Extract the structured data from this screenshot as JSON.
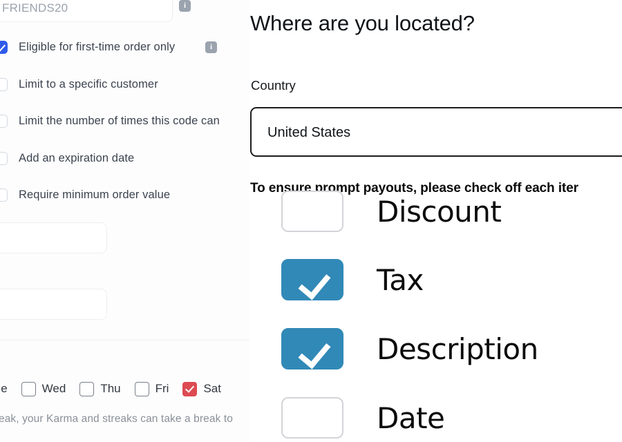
{
  "left_panel": {
    "promo_input": {
      "placeholder": "FRIENDS20",
      "value": ""
    },
    "info_icon_name": "info-icon",
    "options": [
      {
        "label": "Eligible for first-time order only",
        "checked": true,
        "has_info": true
      },
      {
        "label": "Limit to a specific customer",
        "checked": false,
        "has_info": false
      },
      {
        "label": "Limit the number of times this code can",
        "checked": false,
        "has_info": false
      },
      {
        "label": "Add an expiration date",
        "checked": false,
        "has_info": false
      },
      {
        "label": "Require minimum order value",
        "checked": false,
        "has_info": false
      }
    ],
    "weekdays": [
      {
        "label": "Tue",
        "checked": false,
        "box_visible": false
      },
      {
        "label": "Wed",
        "checked": false,
        "box_visible": true
      },
      {
        "label": "Thu",
        "checked": false,
        "box_visible": true
      },
      {
        "label": "Fri",
        "checked": false,
        "box_visible": true
      },
      {
        "label": "Sat",
        "checked": true,
        "box_visible": true
      }
    ],
    "karma_note": "break, your Karma and streaks can take a break to",
    "colors": {
      "checkbox_blue": "#2f5bea",
      "checkbox_red": "#dd4a52",
      "info_badge_gray": "#9aa3ae",
      "placeholder_gray": "#9aa2ad",
      "panel_background": "#fdfdfd"
    }
  },
  "right_panel": {
    "title": "Where are you located?",
    "country_label": "Country",
    "country_value": "United States",
    "payout_note": "To ensure prompt payouts, please check off each iter",
    "checklist": [
      {
        "label": "Discount",
        "checked": false
      },
      {
        "label": "Tax",
        "checked": true
      },
      {
        "label": "Description",
        "checked": true
      },
      {
        "label": "Date",
        "checked": false
      }
    ],
    "colors": {
      "checked_blue": "#3189b7",
      "unchecked_border": "#d2d4d7",
      "select_border": "#1c1c1c",
      "text_black": "#101418"
    }
  }
}
